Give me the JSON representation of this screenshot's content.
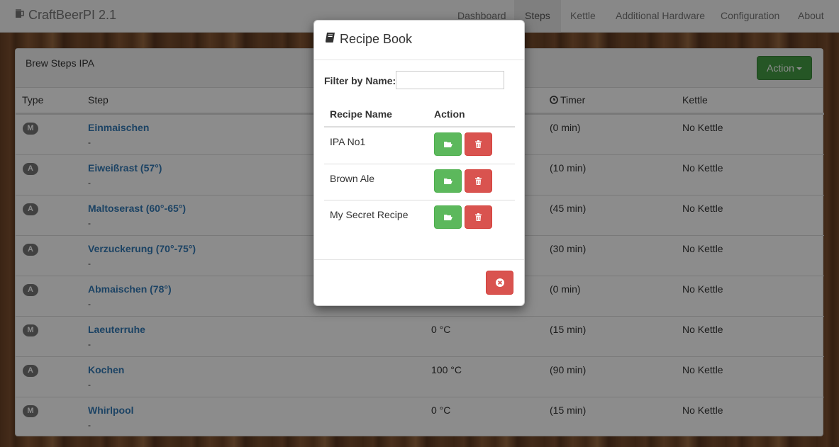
{
  "nav": {
    "brand": "CraftBeerPI 2.1",
    "items": [
      {
        "label": "Dashboard"
      },
      {
        "label": "Steps",
        "active": true
      },
      {
        "label": "Kettle"
      },
      {
        "label": "Additional Hardware"
      },
      {
        "label": "Configuration"
      },
      {
        "label": "About"
      }
    ]
  },
  "panel": {
    "title": "Brew Steps IPA",
    "action_label": "Action"
  },
  "table": {
    "headers": {
      "type": "Type",
      "step": "Step",
      "timer": "Timer",
      "kettle": "Kettle"
    },
    "rows": [
      {
        "type": "M",
        "name": "Einmaischen",
        "sub": "-",
        "temp": "",
        "timer": "(0 min)",
        "kettle": "No Kettle"
      },
      {
        "type": "A",
        "name": "Eiweißrast (57°)",
        "sub": "-",
        "temp": "",
        "timer": "(10 min)",
        "kettle": "No Kettle"
      },
      {
        "type": "A",
        "name": "Maltoserast (60°-65°)",
        "sub": "-",
        "temp": "",
        "timer": "(45 min)",
        "kettle": "No Kettle"
      },
      {
        "type": "A",
        "name": "Verzuckerung (70°-75°)",
        "sub": "-",
        "temp": "",
        "timer": "(30 min)",
        "kettle": "No Kettle"
      },
      {
        "type": "A",
        "name": "Abmaischen (78°)",
        "sub": "-",
        "temp": "",
        "timer": "(0 min)",
        "kettle": "No Kettle"
      },
      {
        "type": "M",
        "name": "Laeuterruhe",
        "sub": "-",
        "temp": "0 °C",
        "timer": "(15 min)",
        "kettle": "No Kettle"
      },
      {
        "type": "A",
        "name": "Kochen",
        "sub": "-",
        "temp": "100 °C",
        "timer": "(90 min)",
        "kettle": "No Kettle"
      },
      {
        "type": "M",
        "name": "Whirlpool",
        "sub": "-",
        "temp": "0 °C",
        "timer": "(15 min)",
        "kettle": "No Kettle"
      }
    ]
  },
  "modal": {
    "title": "Recipe Book",
    "filter_label": "Filter by Name:",
    "filter_value": "",
    "filter_placeholder": "",
    "col_name": "Recipe Name",
    "col_action": "Action",
    "recipes": [
      {
        "name": "IPA No1"
      },
      {
        "name": "Brown Ale"
      },
      {
        "name": "My Secret Recipe"
      }
    ]
  },
  "colors": {
    "success": "#5cb85c",
    "danger": "#d9534f",
    "link": "#337ab7",
    "badge": "#777777"
  }
}
